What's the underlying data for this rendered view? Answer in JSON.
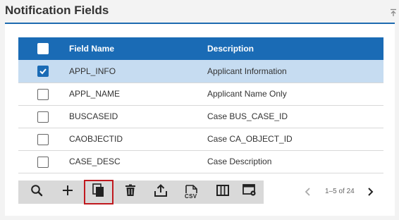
{
  "panel": {
    "title": "Notification Fields"
  },
  "table": {
    "columns": [
      "Field Name",
      "Description"
    ],
    "rows": [
      {
        "name": "APPL_INFO",
        "description": "Applicant Information",
        "checked": true
      },
      {
        "name": "APPL_NAME",
        "description": "Applicant Name Only",
        "checked": false
      },
      {
        "name": "BUSCASEID",
        "description": "Case BUS_CASE_ID",
        "checked": false
      },
      {
        "name": "CAOBJECTID",
        "description": "Case CA_OBJECT_ID",
        "checked": false
      },
      {
        "name": "CASE_DESC",
        "description": "Case Description",
        "checked": false
      }
    ]
  },
  "toolbar": {
    "buttons": [
      "search-icon",
      "add-icon",
      "copy-icon",
      "delete-icon",
      "export-icon",
      "csv-icon",
      "columns-icon",
      "settings-icon"
    ],
    "csv_label": "CSV"
  },
  "pager": {
    "info": "1–5 of 24"
  },
  "colors": {
    "accent": "#1a6bb5",
    "selected_row": "#c6dcf1",
    "highlight": "#c0191f"
  }
}
